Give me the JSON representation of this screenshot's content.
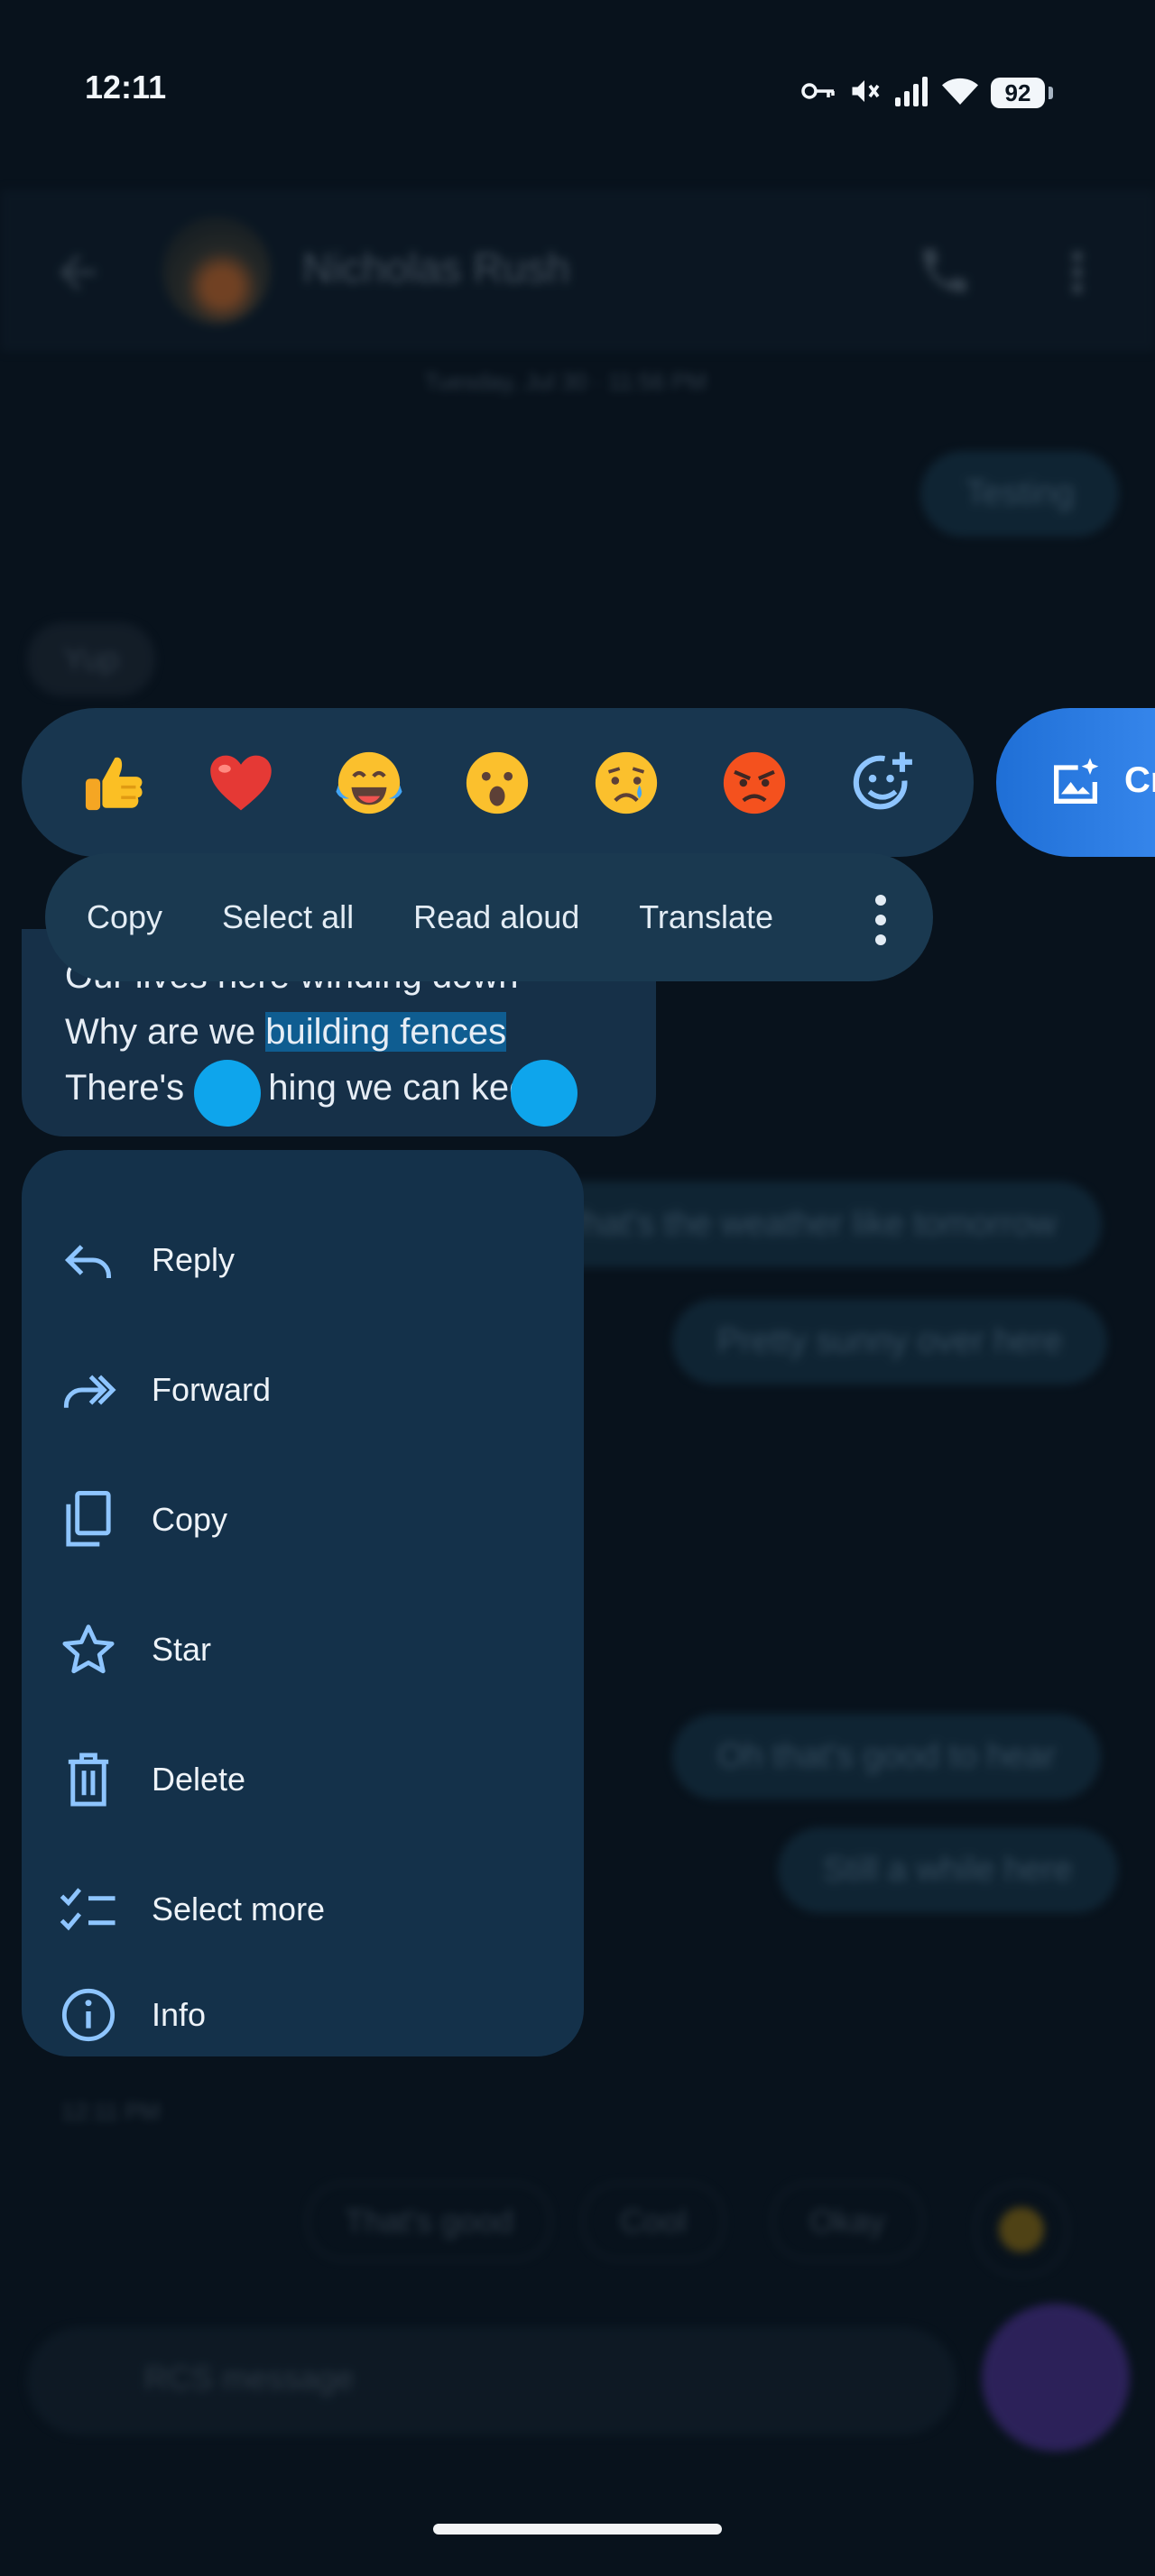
{
  "status_bar": {
    "time": "12:11",
    "battery": "92",
    "icons": [
      "key-icon",
      "mute-icon",
      "signal-icon",
      "wifi-icon",
      "battery-icon"
    ]
  },
  "background": {
    "contact_name": "Nicholas Rush",
    "date_divider": "Tuesday, Jul 30 · 11:56 PM",
    "messages": {
      "m1": "Testing",
      "m2": "Yup",
      "m3": "What's the weather like tomorrow",
      "m4": "Pretty sunny over here",
      "m5": "Oh that's good to hear",
      "m6": "Still a while here"
    },
    "timestamp": "12:11 PM",
    "smart_replies": {
      "r1": "That's good",
      "r2": "Cool",
      "r3": "Okay"
    },
    "input_placeholder": "RCS message"
  },
  "reactions": {
    "items": [
      "thumbs-up",
      "heart",
      "laughing-tears",
      "surprised",
      "crying",
      "angry",
      "add-emoji"
    ],
    "create_label": "Cr"
  },
  "selection_toolbar": {
    "copy": "Copy",
    "select_all": "Select all",
    "read_aloud": "Read aloud",
    "translate": "Translate"
  },
  "message": {
    "line1": "Our lives here winding down",
    "line2_pre": "Why are we ",
    "line2_sel": "building fences",
    "line3_a": "There's ",
    "line3_b": "hing we can kee",
    "line3_c": "t"
  },
  "context_menu": {
    "reply": "Reply",
    "forward": "Forward",
    "copy": "Copy",
    "star": "Star",
    "delete": "Delete",
    "select_more": "Select more",
    "info": "Info"
  },
  "colors": {
    "background": "#08121c",
    "menu": "#14314a",
    "selection_highlight": "#0f5d91",
    "selection_handle": "#0ea5ec",
    "accent_blue": "#1f6fd6"
  }
}
